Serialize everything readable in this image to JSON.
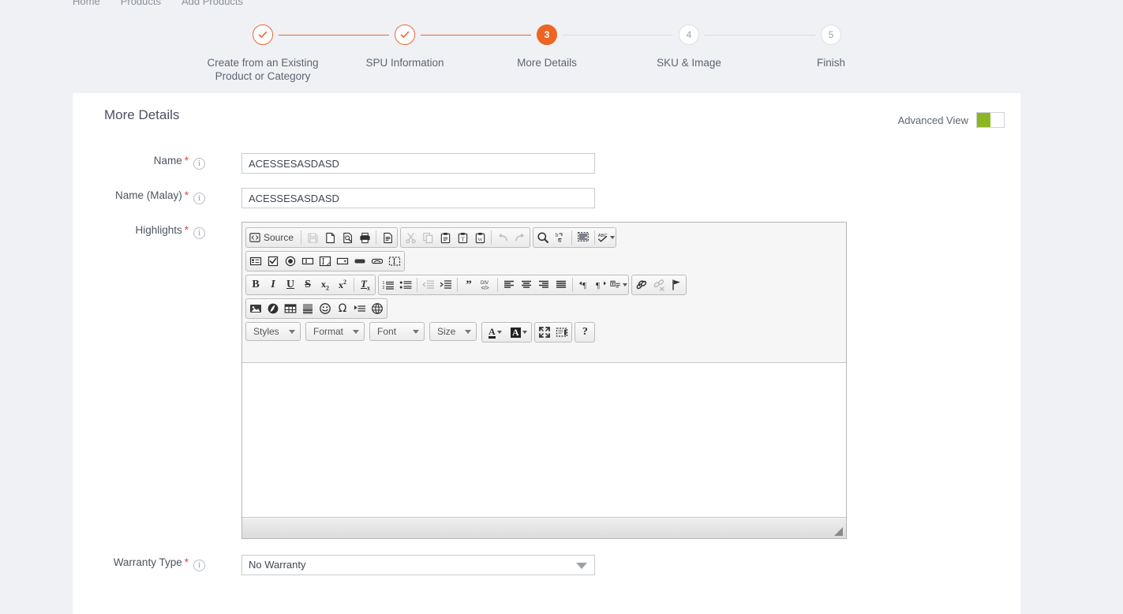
{
  "breadcrumb": {
    "items": [
      "Home",
      "Products",
      "Add Products"
    ]
  },
  "stepper": {
    "steps": [
      {
        "label": "Create from an Existing\nProduct or Category",
        "number": "1",
        "state": "done",
        "mark": "✓"
      },
      {
        "label": "SPU Information",
        "number": "2",
        "state": "done",
        "mark": "✓"
      },
      {
        "label": "More Details",
        "number": "3",
        "state": "active",
        "mark": "3"
      },
      {
        "label": "SKU & Image",
        "number": "4",
        "state": "todo",
        "mark": "4"
      },
      {
        "label": "Finish",
        "number": "5",
        "state": "todo",
        "mark": "5"
      }
    ],
    "done_color": "#e8663a",
    "active_color": "#ee6422",
    "todo_color": "#d8dbdf"
  },
  "card": {
    "title": "More Details",
    "advanced_view": {
      "label": "Advanced View",
      "state": "on",
      "on_color": "#8cb723"
    }
  },
  "form": {
    "name": {
      "label": "Name",
      "required": "*",
      "value": "ACESSESASDASD",
      "placeholder": ""
    },
    "name_malay": {
      "label": "Name (Malay)",
      "required": "*",
      "value": "ACESSESASDASD",
      "placeholder": ""
    },
    "highlights": {
      "label": "Highlights",
      "required": "*"
    },
    "warranty_type": {
      "label": "Warranty Type",
      "required": "*",
      "value": "No Warranty",
      "options": [
        "No Warranty"
      ]
    },
    "info_glyph": "i"
  },
  "editor": {
    "source_label": "Source",
    "content": "",
    "rows": [
      {
        "groups": [
          {
            "buttons": [
              {
                "name": "source-button",
                "label": "Source",
                "wide": true,
                "disabled": false
              },
              {
                "name": "separator",
                "sep": true
              },
              {
                "name": "save-icon",
                "disabled": true
              },
              {
                "name": "new-page-icon",
                "disabled": false
              },
              {
                "name": "preview-icon",
                "disabled": false
              },
              {
                "name": "print-icon",
                "disabled": false
              },
              {
                "name": "separator",
                "sep": true
              },
              {
                "name": "templates-icon",
                "disabled": false
              }
            ]
          },
          {
            "buttons": [
              {
                "name": "cut-icon",
                "disabled": true
              },
              {
                "name": "copy-icon",
                "disabled": true
              },
              {
                "name": "paste-icon",
                "disabled": false
              },
              {
                "name": "paste-text-icon",
                "disabled": false
              },
              {
                "name": "paste-word-icon",
                "disabled": false
              },
              {
                "name": "separator",
                "sep": true
              },
              {
                "name": "undo-icon",
                "disabled": true
              },
              {
                "name": "redo-icon",
                "disabled": true
              }
            ]
          },
          {
            "buttons": [
              {
                "name": "find-icon",
                "disabled": false
              },
              {
                "name": "replace-icon",
                "disabled": false
              },
              {
                "name": "separator",
                "sep": true
              },
              {
                "name": "select-all-icon",
                "disabled": false
              },
              {
                "name": "separator",
                "sep": true
              },
              {
                "name": "spell-check-icon",
                "disabled": false,
                "caret": true
              }
            ]
          }
        ]
      },
      {
        "groups": [
          {
            "buttons": [
              {
                "name": "form-icon",
                "disabled": false
              },
              {
                "name": "checkbox-icon",
                "disabled": false
              },
              {
                "name": "radio-button-icon",
                "disabled": false
              },
              {
                "name": "text-field-icon",
                "disabled": false
              },
              {
                "name": "textarea-icon",
                "disabled": false
              },
              {
                "name": "select-field-icon",
                "disabled": false
              },
              {
                "name": "button-icon",
                "disabled": false
              },
              {
                "name": "image-button-icon",
                "disabled": false
              },
              {
                "name": "hidden-field-icon",
                "disabled": false
              }
            ]
          }
        ]
      },
      {
        "groups": [
          {
            "buttons": [
              {
                "name": "bold-icon",
                "glyph": "B",
                "disabled": false
              },
              {
                "name": "italic-icon",
                "glyph": "I",
                "disabled": false
              },
              {
                "name": "underline-icon",
                "glyph": "U",
                "disabled": false
              },
              {
                "name": "strikethrough-icon",
                "glyph": "S",
                "disabled": false
              },
              {
                "name": "subscript-icon",
                "disabled": false
              },
              {
                "name": "superscript-icon",
                "disabled": false
              },
              {
                "name": "separator",
                "sep": true
              },
              {
                "name": "remove-format-icon",
                "disabled": false
              }
            ]
          },
          {
            "buttons": [
              {
                "name": "numbered-list-icon",
                "disabled": false
              },
              {
                "name": "bulleted-list-icon",
                "disabled": false
              },
              {
                "name": "separator",
                "sep": true
              },
              {
                "name": "decrease-indent-icon",
                "disabled": true
              },
              {
                "name": "increase-indent-icon",
                "disabled": false
              },
              {
                "name": "separator",
                "sep": true
              },
              {
                "name": "blockquote-icon",
                "disabled": false
              },
              {
                "name": "create-div-icon",
                "disabled": false
              },
              {
                "name": "separator",
                "sep": true
              },
              {
                "name": "align-left-icon",
                "disabled": false
              },
              {
                "name": "align-center-icon",
                "disabled": false
              },
              {
                "name": "align-right-icon",
                "disabled": false
              },
              {
                "name": "justify-icon",
                "disabled": false
              },
              {
                "name": "separator",
                "sep": true
              },
              {
                "name": "text-direction-ltr-icon",
                "disabled": false
              },
              {
                "name": "text-direction-rtl-icon",
                "disabled": false
              },
              {
                "name": "language-icon",
                "disabled": false,
                "caret": true
              }
            ]
          },
          {
            "buttons": [
              {
                "name": "link-icon",
                "disabled": false
              },
              {
                "name": "unlink-icon",
                "disabled": true
              },
              {
                "name": "anchor-icon",
                "disabled": false
              }
            ]
          }
        ]
      },
      {
        "groups": [
          {
            "buttons": [
              {
                "name": "image-icon",
                "disabled": false
              },
              {
                "name": "flash-icon",
                "disabled": false
              },
              {
                "name": "table-icon",
                "disabled": false
              },
              {
                "name": "horizontal-rule-icon",
                "disabled": false
              },
              {
                "name": "smiley-icon",
                "disabled": false
              },
              {
                "name": "special-character-icon",
                "disabled": false
              },
              {
                "name": "page-break-icon",
                "disabled": false
              },
              {
                "name": "iframe-icon",
                "disabled": false
              }
            ]
          }
        ]
      }
    ],
    "combos": [
      {
        "name": "styles-combo",
        "label": "Styles"
      },
      {
        "name": "format-combo",
        "label": "Format"
      },
      {
        "name": "font-combo",
        "label": "Font"
      },
      {
        "name": "size-combo",
        "label": "Size"
      }
    ],
    "color_buttons": [
      {
        "name": "text-color-icon",
        "glyph": "A"
      },
      {
        "name": "background-color-icon",
        "glyph": "A"
      }
    ],
    "tool_buttons": [
      {
        "name": "maximize-icon"
      },
      {
        "name": "show-blocks-icon"
      }
    ],
    "about_button": {
      "name": "about-icon",
      "glyph": "?"
    }
  }
}
